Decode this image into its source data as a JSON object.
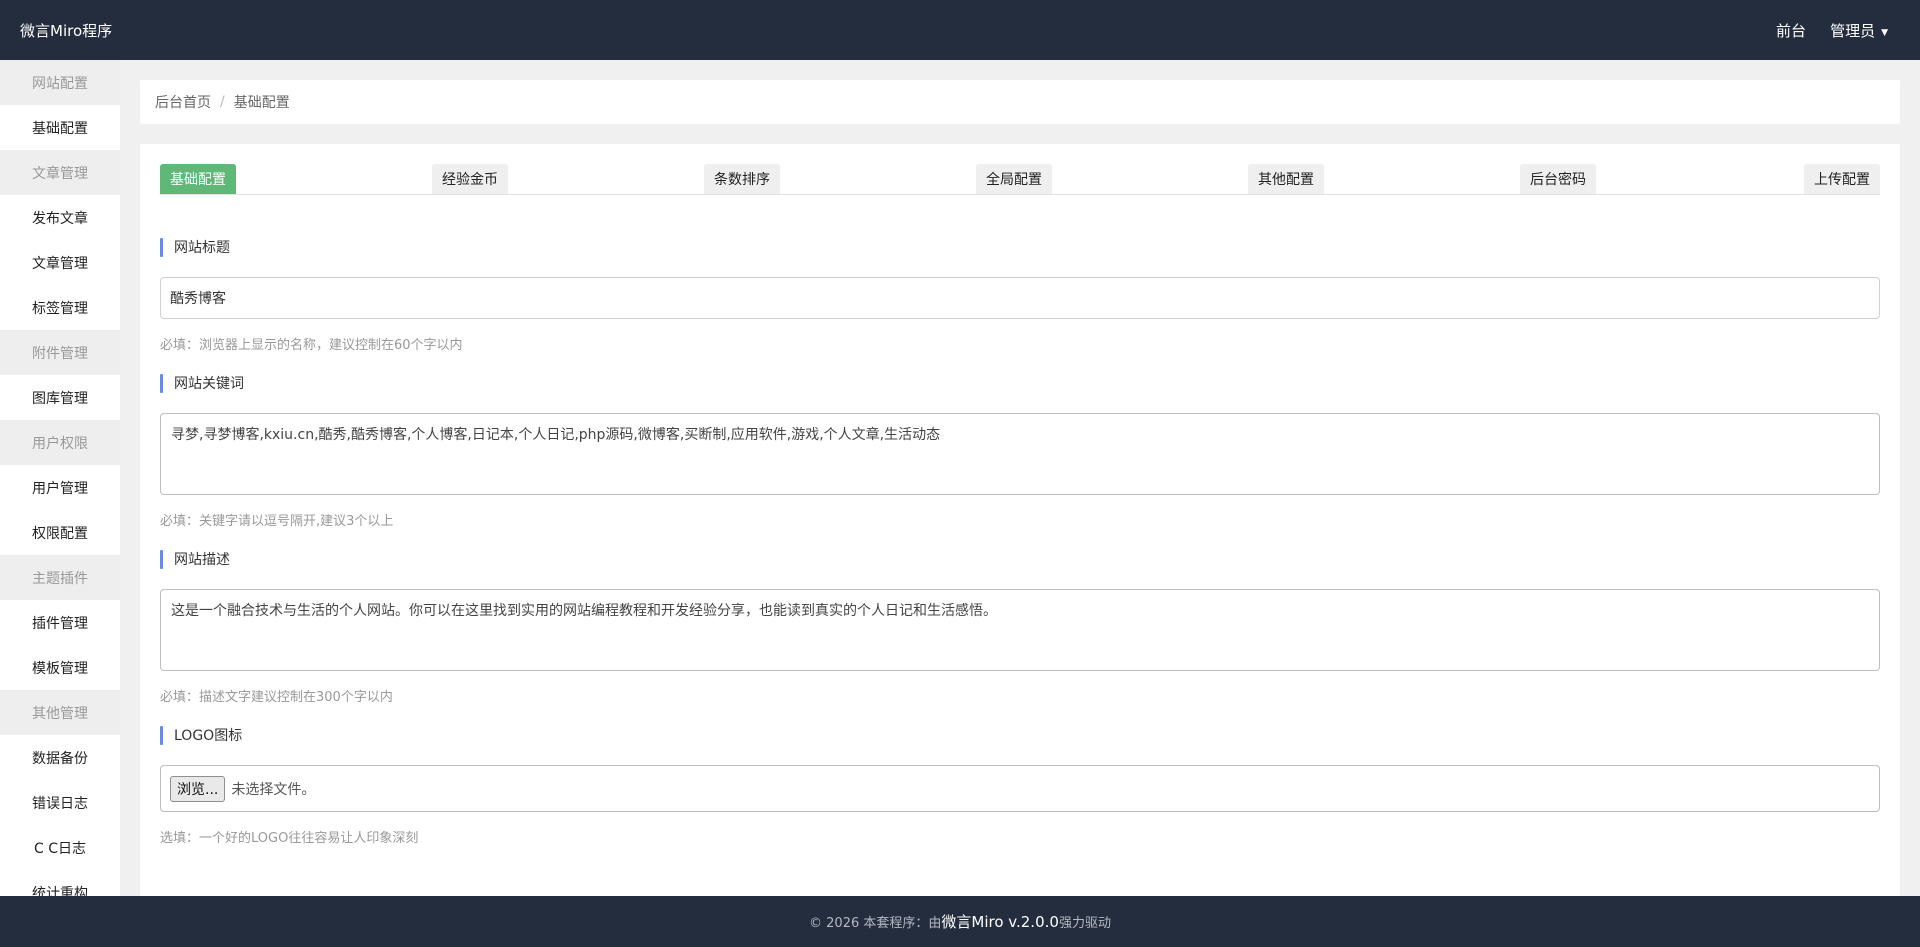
{
  "header": {
    "brand": "微言Miro程序",
    "front_link": "前台",
    "user_menu": "管理员",
    "caret_icon": "▼"
  },
  "sidebar": {
    "items": [
      {
        "label": "网站配置",
        "group": true
      },
      {
        "label": "基础配置",
        "group": false
      },
      {
        "label": "文章管理",
        "group": true
      },
      {
        "label": "发布文章",
        "group": false
      },
      {
        "label": "文章管理",
        "group": false
      },
      {
        "label": "标签管理",
        "group": false
      },
      {
        "label": "附件管理",
        "group": true
      },
      {
        "label": "图库管理",
        "group": false
      },
      {
        "label": "用户权限",
        "group": true
      },
      {
        "label": "用户管理",
        "group": false
      },
      {
        "label": "权限配置",
        "group": false
      },
      {
        "label": "主题插件",
        "group": true
      },
      {
        "label": "插件管理",
        "group": false
      },
      {
        "label": "模板管理",
        "group": false
      },
      {
        "label": "其他管理",
        "group": true
      },
      {
        "label": "数据备份",
        "group": false
      },
      {
        "label": "错误日志",
        "group": false
      },
      {
        "label": "C C日志",
        "group": false
      },
      {
        "label": "统计重构",
        "group": false
      }
    ]
  },
  "breadcrumb": {
    "home": "后台首页",
    "separator": "/",
    "current": "基础配置"
  },
  "tabs": [
    {
      "label": "基础配置",
      "active": true
    },
    {
      "label": "经验金币",
      "active": false
    },
    {
      "label": "条数排序",
      "active": false
    },
    {
      "label": "全局配置",
      "active": false
    },
    {
      "label": "其他配置",
      "active": false
    },
    {
      "label": "后台密码",
      "active": false
    },
    {
      "label": "上传配置",
      "active": false
    }
  ],
  "form": {
    "title": {
      "label": "网站标题",
      "value": "酷秀博客",
      "help": "必填：浏览器上显示的名称，建议控制在60个字以内"
    },
    "keywords": {
      "label": "网站关键词",
      "value": "寻梦,寻梦博客,kxiu.cn,酷秀,酷秀博客,个人博客,日记本,个人日记,php源码,微博客,买断制,应用软件,游戏,个人文章,生活动态",
      "help": "必填：关键字请以逗号隔开,建议3个以上"
    },
    "description": {
      "label": "网站描述",
      "value": "这是一个融合技术与生活的个人网站。你可以在这里找到实用的网站编程教程和开发经验分享，也能读到真实的个人日记和生活感悟。",
      "help": "必填：描述文字建议控制在300个字以内"
    },
    "logo": {
      "label": "LOGO图标",
      "browse_label": "浏览...",
      "file_status": "未选择文件。",
      "help": "选填：一个好的LOGO往往容易让人印象深刻"
    }
  },
  "footer": {
    "prefix": "© 2026 本套程序：由",
    "product": "微言Miro v.2.0.0",
    "suffix": "强力驱动"
  },
  "colors": {
    "topbar": "#232d3d",
    "active_tab": "#5fb878",
    "accent_bar": "#6c8ae4"
  }
}
